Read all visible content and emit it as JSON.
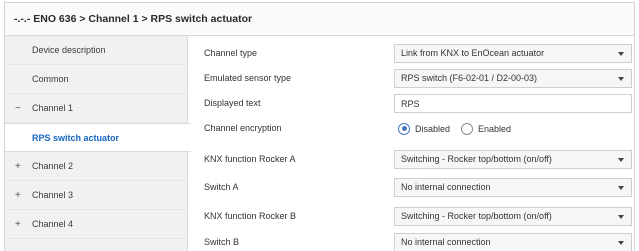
{
  "window": {
    "title": "-.-.- ENO 636 > Channel 1 > RPS switch actuator"
  },
  "sidebar": {
    "items": [
      {
        "label": "Device description",
        "type": "leaf",
        "sign": ""
      },
      {
        "label": "Common",
        "type": "leaf",
        "sign": ""
      },
      {
        "label": "Channel 1",
        "type": "group",
        "sign": "−"
      },
      {
        "label": "RPS switch actuator",
        "type": "selected",
        "sign": ""
      },
      {
        "label": "Channel 2",
        "type": "group",
        "sign": "+"
      },
      {
        "label": "Channel 3",
        "type": "group",
        "sign": "+"
      },
      {
        "label": "Channel 4",
        "type": "group",
        "sign": "+"
      }
    ]
  },
  "params": {
    "channel_type": {
      "label": "Channel type",
      "value": "Link from KNX to EnOcean actuator"
    },
    "emulated_sensor_type": {
      "label": "Emulated sensor type",
      "value": "RPS switch (F6-02-01 / D2-00-03)"
    },
    "displayed_text": {
      "label": "Displayed text",
      "value": "RPS"
    },
    "channel_encryption": {
      "label": "Channel encryption",
      "options": [
        "Disabled",
        "Enabled"
      ],
      "selected": "Disabled"
    },
    "knx_function_rocker_a": {
      "label": "KNX function Rocker A",
      "value": "Switching - Rocker top/bottom (on/off)"
    },
    "switch_a": {
      "label": "Switch A",
      "value": "No internal connection"
    },
    "knx_function_rocker_b": {
      "label": "KNX function Rocker B",
      "value": "Switching - Rocker top/bottom (on/off)"
    },
    "switch_b": {
      "label": "Switch B",
      "value": "No internal connection"
    }
  },
  "icons": {
    "dropdown": "caret-down-icon",
    "expanded": "minus-icon",
    "collapsed": "plus-icon"
  },
  "colors": {
    "accent": "#1565c0",
    "radio_selected": "#4a78c2",
    "sidebar_bg": "#f1f1f1"
  }
}
